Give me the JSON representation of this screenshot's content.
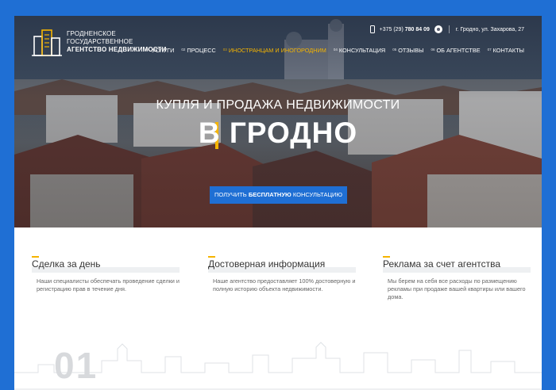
{
  "brand": {
    "line1": "ГРОДНЕНСКОЕ",
    "line2": "ГОСУДАРСТВЕННОЕ",
    "line3": "АГЕНТСТВО НЕДВИЖИМОСТИ",
    "accent": "#f5b400"
  },
  "contact": {
    "phone_prefix": "+375 (29)",
    "phone_number": "780 84 09",
    "address": "г. Гродно, ул. Захарова, 27"
  },
  "nav": {
    "items": [
      {
        "num": "01",
        "label": "УСЛУГИ"
      },
      {
        "num": "02",
        "label": "ПРОЦЕСС"
      },
      {
        "num": "03",
        "label": "ИНОСТРАНЦАМ И ИНОГОРОДНИМ"
      },
      {
        "num": "04",
        "label": "КОНСУЛЬТАЦИЯ"
      },
      {
        "num": "05",
        "label": "ОТЗЫВЫ"
      },
      {
        "num": "06",
        "label": "ОБ АГЕНТСТВЕ"
      },
      {
        "num": "07",
        "label": "КОНТАКТЫ"
      }
    ],
    "active_index": 2
  },
  "hero": {
    "subtitle": "КУПЛЯ И ПРОДАЖА НЕДВИЖИМОСТИ",
    "title": "В ГРОДНО",
    "cta_part1": "ПОЛУЧИТЬ",
    "cta_part2": "БЕСПЛАТНУЮ",
    "cta_part3": "КОНСУЛЬТАЦИЮ"
  },
  "features": [
    {
      "title": "Сделка за день",
      "text": "Наши специалисты обеспечать проведение сделки и регистрацию прав в течение дня."
    },
    {
      "title": "Достоверная информация",
      "text": "Наше агентство предоставляет 100% достоверную и полную историю объекта недвижимости."
    },
    {
      "title": "Реклама за счет агентства",
      "text": "Мы берем на себя все расходы по размещению рекламы при продаже вашей квартиры или вашего дома."
    }
  ],
  "section_number": "01",
  "colors": {
    "primary": "#1f6fd4",
    "accent": "#f5b400"
  }
}
